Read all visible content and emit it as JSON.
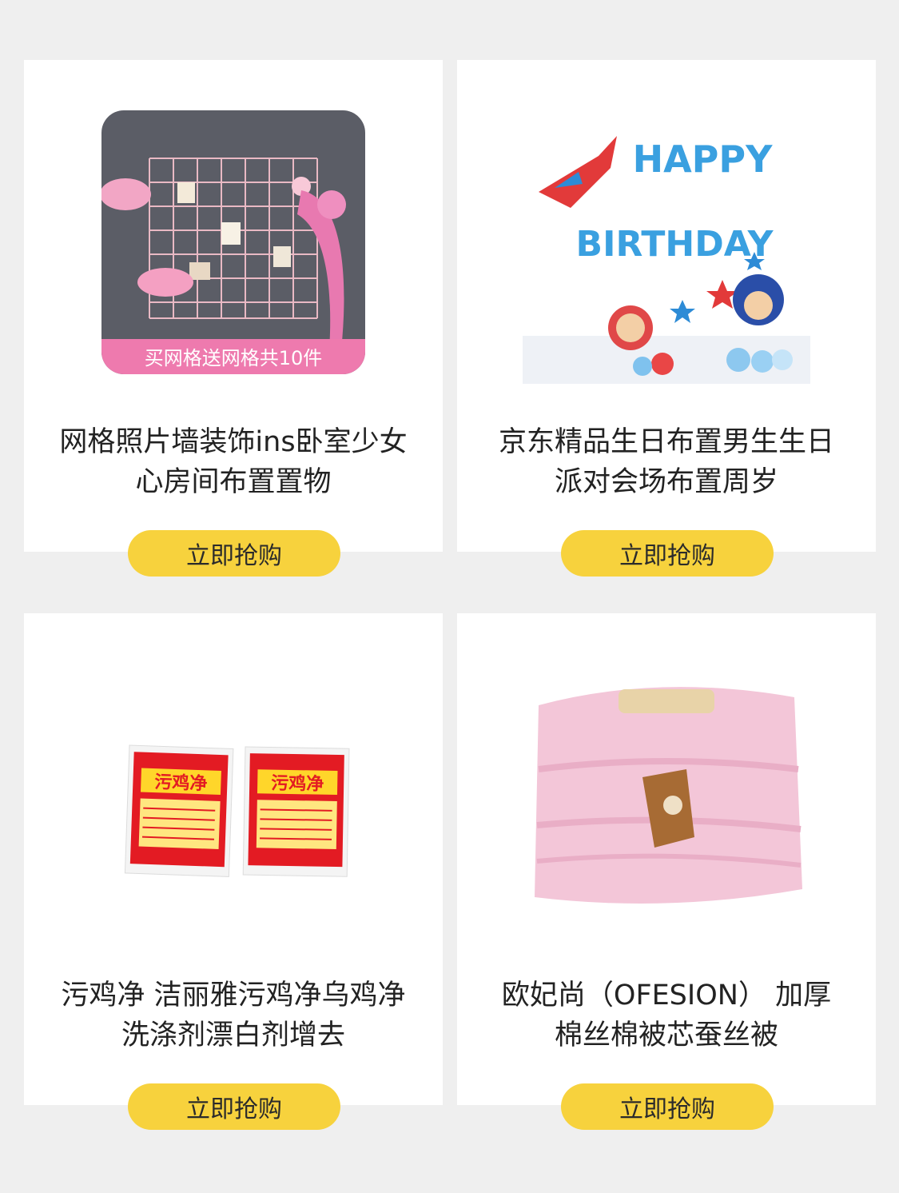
{
  "products": [
    {
      "title": "网格照片墙装饰ins卧室少女心房间布置置物",
      "image_banner": "买网格送网格共10件",
      "image_icon": "photo-grid-wall-image",
      "button_label": "立即抢购"
    },
    {
      "title": "京东精品生日布置男生生日派对会场布置周岁",
      "image_text_line1": "HAPPY",
      "image_text_line2": "BIRTHDAY",
      "image_icon": "birthday-balloon-image",
      "button_label": "立即抢购"
    },
    {
      "title": "污鸡净 洁丽雅污鸡净乌鸡净洗涤剂漂白剂增去",
      "image_pack_label": "污鸡净",
      "image_icon": "detergent-packet-image",
      "button_label": "立即抢购"
    },
    {
      "title": "欧妃尚（OFESION） 加厚棉丝棉被芯蚕丝被",
      "image_icon": "pink-quilt-image",
      "button_label": "立即抢购"
    }
  ],
  "colors": {
    "background": "#efefef",
    "card": "#ffffff",
    "button": "#f7d23d",
    "text": "#222222"
  }
}
